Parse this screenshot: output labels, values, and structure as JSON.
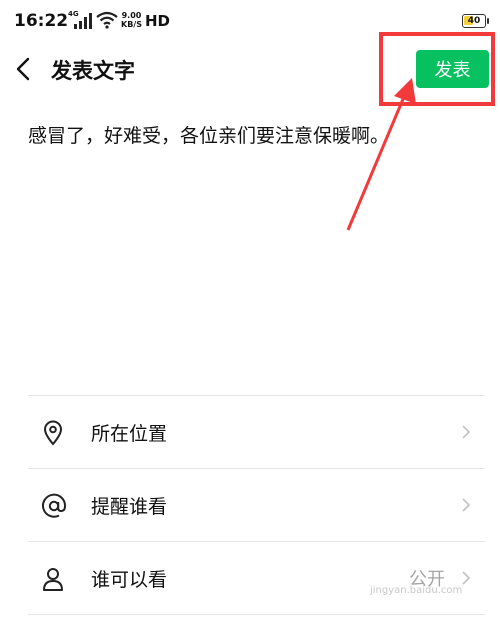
{
  "status_bar": {
    "time": "16:22",
    "network": "4G",
    "speed_value": "9.00",
    "speed_unit": "KB/S",
    "hd": "HD",
    "battery": "40"
  },
  "header": {
    "title": "发表文字",
    "publish_label": "发表",
    "publish_color": "#07c160",
    "highlight_color": "#f23a3a"
  },
  "post": {
    "text": "感冒了，好难受，各位亲们要注意保暖啊。"
  },
  "options": [
    {
      "icon": "location-pin-icon",
      "label": "所在位置",
      "value": ""
    },
    {
      "icon": "at-sign-icon",
      "label": "提醒谁看",
      "value": ""
    },
    {
      "icon": "person-icon",
      "label": "谁可以看",
      "value": "公开"
    }
  ],
  "watermark": "jingyan.baidu.com"
}
